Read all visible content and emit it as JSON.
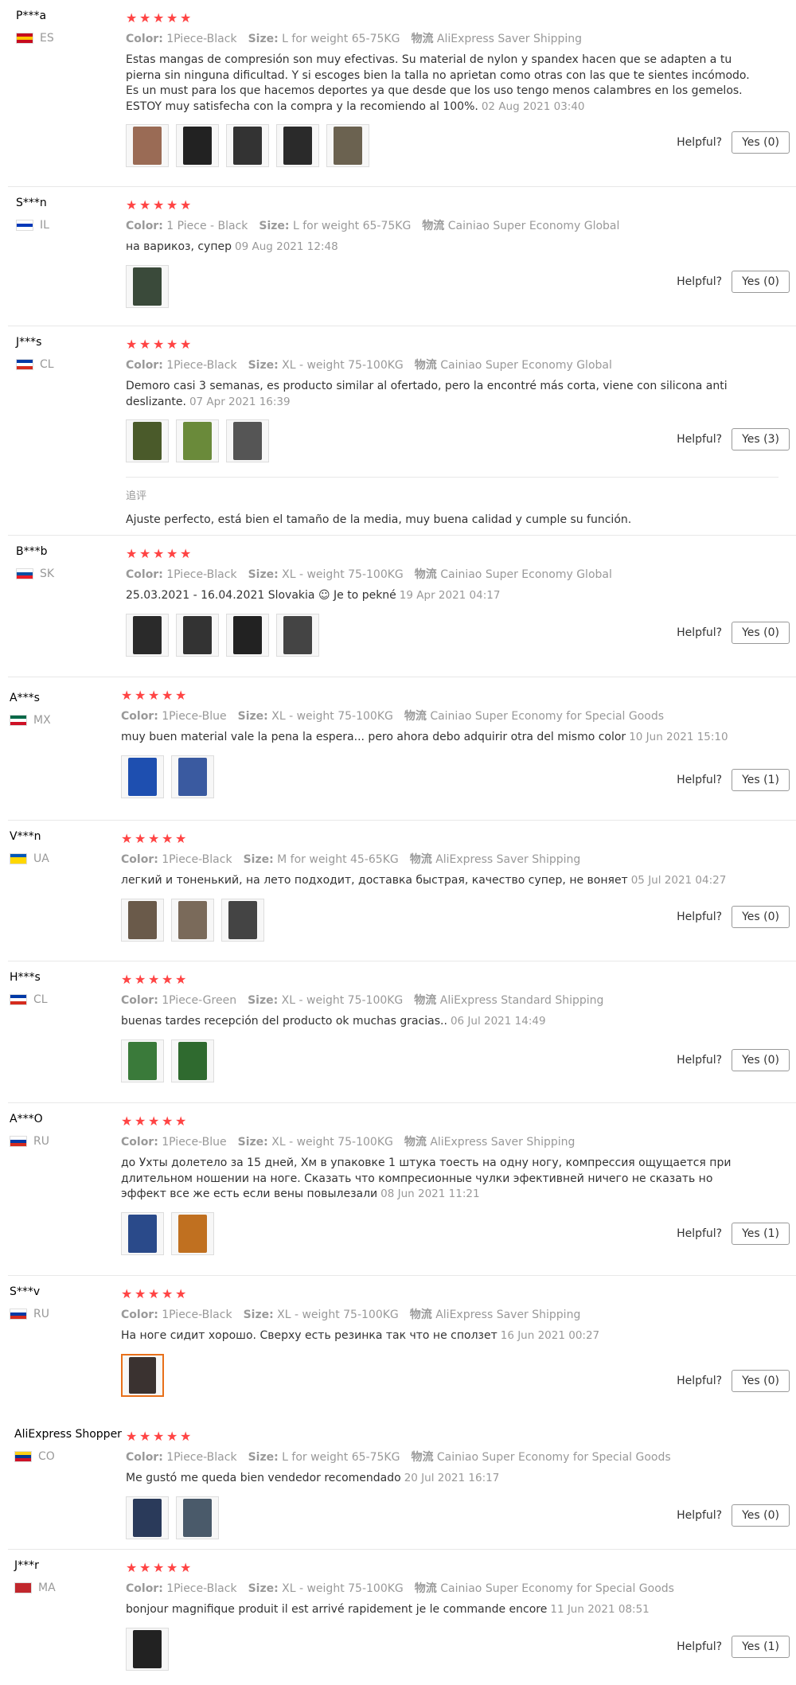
{
  "helpful_label": "Helpful?",
  "color_label": "Color:",
  "size_label": "Size:",
  "ship_label": "物流",
  "star_glyph": "★",
  "reviews": [
    {
      "user": "P***a",
      "country": "ES",
      "flag_colors": [
        "#c60b1e",
        "#ffc400",
        "#c60b1e"
      ],
      "color": "1Piece-Black",
      "size": "L for weight 65-75KG",
      "shipping": "AliExpress Saver Shipping",
      "text": "Estas mangas de compresión son muy efectivas. Su material de nylon y spandex hacen que se adapten a tu pierna sin ninguna dificultad. Y si escoges bien la talla no aprietan como otras con las que te sientes incómodo. Es un must para los que hacemos deportes ya que desde que los uso tengo menos calambres en los gemelos. ESTOY muy satisfecha con la compra y la recomiendo al 100%.",
      "date": "02 Aug 2021 03:40",
      "photos": 5,
      "photo_colors": [
        "#9a6b55",
        "#222",
        "#333",
        "#2a2a2a",
        "#6b6250"
      ],
      "yes": "Yes (0)"
    },
    {
      "user": "S***n",
      "country": "IL",
      "flag_colors": [
        "#ffffff",
        "#0038b8",
        "#ffffff"
      ],
      "color": "1 Piece - Black",
      "size": "L for weight 65-75KG",
      "shipping": "Cainiao Super Economy Global",
      "text": "на варикоз, супер",
      "date": "09 Aug 2021 12:48",
      "photos": 1,
      "photo_colors": [
        "#3a4a3a"
      ],
      "yes": "Yes (0)"
    },
    {
      "user": "J***s",
      "country": "CL",
      "flag_colors": [
        "#0039a6",
        "#ffffff",
        "#d52b1e"
      ],
      "color": "1Piece-Black",
      "size": "XL - weight 75-100KG",
      "shipping": "Cainiao Super Economy Global",
      "text": "Demoro casi 3 semanas, es producto similar al ofertado, pero la encontré más corta, viene con silicona anti deslizante.",
      "date": "07 Apr 2021 16:39",
      "photos": 3,
      "photo_colors": [
        "#4a5a2a",
        "#6a8a3a",
        "#555"
      ],
      "yes": "Yes (3)",
      "additional_label": "追评",
      "additional_text": "Ajuste perfecto, está bien el tamaño de la media, muy buena calidad y cumple su función."
    },
    {
      "user": "B***b",
      "country": "SK",
      "flag_colors": [
        "#ffffff",
        "#0b4ea2",
        "#ee1c25"
      ],
      "color": "1Piece-Black",
      "size": "XL - weight 75-100KG",
      "shipping": "Cainiao Super Economy Global",
      "text": "25.03.2021 - 16.04.2021 Slovakia ☺ Je to pekné",
      "date": "19 Apr 2021 04:17",
      "photos": 4,
      "photo_colors": [
        "#2a2a2a",
        "#333",
        "#222",
        "#444"
      ],
      "yes": "Yes (0)"
    },
    {
      "user": "A***s",
      "country": "MX",
      "flag_colors": [
        "#006847",
        "#ffffff",
        "#ce1126"
      ],
      "color": "1Piece-Blue",
      "size": "XL - weight 75-100KG",
      "shipping": "Cainiao Super Economy for Special Goods",
      "text": "muy buen material vale la pena la espera... pero ahora debo adquirir otra del mismo color",
      "date": "10 Jun 2021 15:10",
      "photos": 2,
      "photo_colors": [
        "#1e4fb0",
        "#3a5aa0"
      ],
      "yes": "Yes (1)"
    },
    {
      "user": "V***n",
      "country": "UA",
      "flag_colors": [
        "#0057b7",
        "#ffd700",
        "#ffd700"
      ],
      "color": "1Piece-Black",
      "size": "M for weight 45-65KG",
      "shipping": "AliExpress Saver Shipping",
      "text": "легкий и тоненький, на лето подходит, доставка быстрая, качество супер, не воняет",
      "date": "05 Jul 2021 04:27",
      "photos": 3,
      "photo_colors": [
        "#6a5a4a",
        "#7a6a5a",
        "#444"
      ],
      "yes": "Yes (0)"
    },
    {
      "user": "H***s",
      "country": "CL",
      "flag_colors": [
        "#0039a6",
        "#ffffff",
        "#d52b1e"
      ],
      "color": "1Piece-Green",
      "size": "XL - weight 75-100KG",
      "shipping": "AliExpress Standard Shipping",
      "text": "buenas tardes recepción del producto ok muchas gracias..",
      "date": "06 Jul 2021 14:49",
      "photos": 2,
      "photo_colors": [
        "#3a7a3a",
        "#2f6a2f"
      ],
      "yes": "Yes (0)"
    },
    {
      "user": "A***O",
      "country": "RU",
      "flag_colors": [
        "#ffffff",
        "#0039a6",
        "#d52b1e"
      ],
      "color": "1Piece-Blue",
      "size": "XL - weight 75-100KG",
      "shipping": "AliExpress Saver Shipping",
      "text": "до Ухты долетело за 15 дней, Хм в упаковке 1 штука тоесть на одну ногу, компрессия ощущается при длительном ношении на ноге. Сказать что компресионные чулки эфективней ничего не сказать но эффект все же есть если вены повылезали",
      "date": "08 Jun 2021 11:21",
      "photos": 2,
      "photo_colors": [
        "#2a4a8a",
        "#c07020"
      ],
      "yes": "Yes (1)"
    },
    {
      "user": "S***v",
      "country": "RU",
      "flag_colors": [
        "#ffffff",
        "#0039a6",
        "#d52b1e"
      ],
      "color": "1Piece-Black",
      "size": "XL - weight 75-100KG",
      "shipping": "AliExpress Saver Shipping",
      "text": "На ноге сидит хорошо. Сверху есть резинка так что не сползет",
      "date": "16 Jun 2021 00:27",
      "photos": 1,
      "photo_colors": [
        "#3a3230"
      ],
      "yes": "Yes (0)",
      "selected_photo": true
    },
    {
      "user": "AliExpress Shopper",
      "country": "CO",
      "flag_colors": [
        "#fcd116",
        "#003893",
        "#ce1126"
      ],
      "color": "1Piece-Black",
      "size": "L for weight 65-75KG",
      "shipping": "Cainiao Super Economy for Special Goods",
      "text": "Me gustó me queda bien vendedor recomendado",
      "date": "20 Jul 2021 16:17",
      "photos": 2,
      "photo_colors": [
        "#2a3a5a",
        "#4a5a6a"
      ],
      "yes": "Yes (0)"
    },
    {
      "user": "J***r",
      "country": "MA",
      "flag_colors": [
        "#c1272d",
        "#c1272d",
        "#c1272d"
      ],
      "color": "1Piece-Black",
      "size": "XL - weight 75-100KG",
      "shipping": "Cainiao Super Economy for Special Goods",
      "text": "bonjour magnifique produit il est arrivé rapidement je le commande encore",
      "date": "11 Jun 2021 08:51",
      "photos": 1,
      "photo_colors": [
        "#222"
      ],
      "yes": "Yes (1)"
    }
  ]
}
